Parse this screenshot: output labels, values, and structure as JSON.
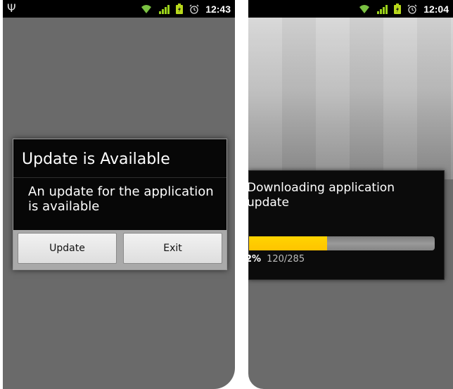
{
  "left_screen": {
    "status_bar": {
      "time": "12:43"
    },
    "dialog": {
      "title": "Update is Available",
      "message": "An update for the application is available",
      "buttons": {
        "update": "Update",
        "exit": "Exit"
      }
    }
  },
  "right_screen": {
    "status_bar": {
      "time": "12:04"
    },
    "progress_dialog": {
      "title": "Downloading application update",
      "percent_text": "2%",
      "count_text": "120/285",
      "progress_fraction": 0.42
    }
  },
  "colors": {
    "progress_fill": "#ffc400",
    "wifi": "#7ac142",
    "signal": "#9bd21b",
    "battery": "#b9d91b"
  },
  "icons": [
    "usb-icon",
    "wifi-icon",
    "signal-icon",
    "battery-icon",
    "alarm-icon"
  ]
}
